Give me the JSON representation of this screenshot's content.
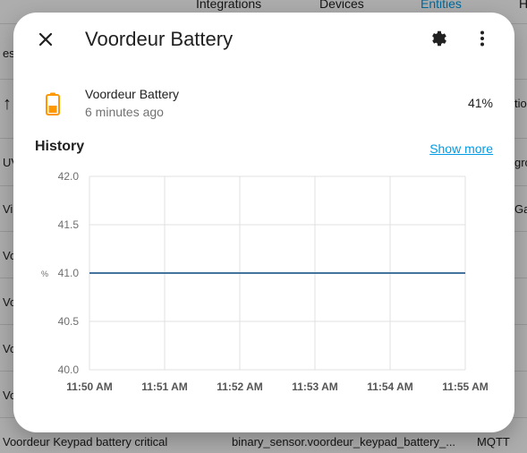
{
  "background": {
    "nav_items": [
      "Integrations",
      "Devices",
      "Entities",
      "H"
    ],
    "left_fragments": [
      "es",
      "",
      "UV",
      "Vi",
      "Vo",
      "Vo",
      "Vo",
      "Vo"
    ],
    "right_fragments": [
      "",
      "tio",
      "gro",
      "Ga"
    ],
    "bottom_row": {
      "name": "Voordeur Keypad battery critical",
      "entity_id": "binary_sensor.voordeur_keypad_battery_...",
      "integration": "MQTT"
    }
  },
  "dialog": {
    "title": "Voordeur Battery",
    "icons": {
      "close": "close-icon",
      "settings": "gear-icon",
      "more": "dots-vertical-icon",
      "battery": "battery-icon"
    },
    "entity": {
      "name": "Voordeur Battery",
      "last_changed": "6 minutes ago",
      "state": "41%",
      "icon_color": "#ff9800"
    },
    "history": {
      "title": "History",
      "show_more": "Show more"
    }
  },
  "chart_data": {
    "type": "line",
    "ylim": [
      40.0,
      42.0
    ],
    "y_ticks": [
      "42.0",
      "41.5",
      "41.0",
      "40.5",
      "40.0"
    ],
    "x_ticks": [
      "11:50 AM",
      "11:51 AM",
      "11:52 AM",
      "11:53 AM",
      "11:54 AM",
      "11:55 AM"
    ],
    "ylabel": "%",
    "series": [
      {
        "color": "#44739e",
        "x": [
          "11:50 AM",
          "11:55 AM"
        ],
        "values": [
          41.0,
          41.0
        ]
      }
    ]
  }
}
